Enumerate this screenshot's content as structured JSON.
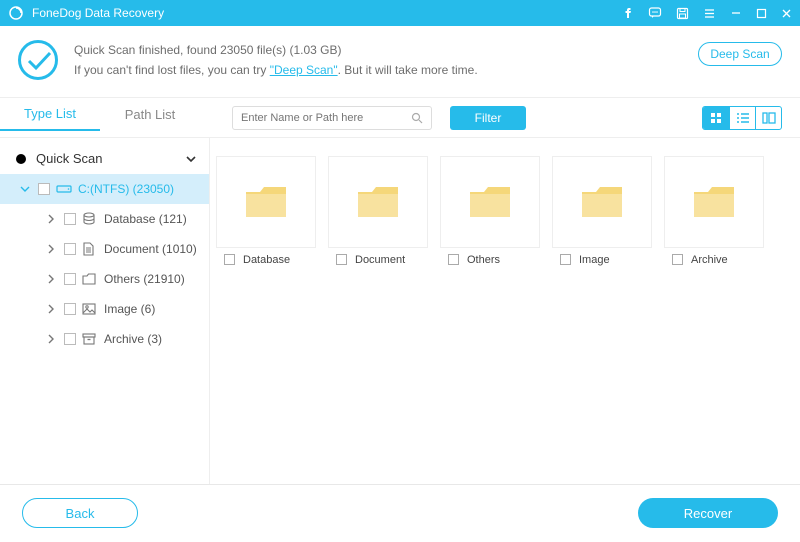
{
  "app": {
    "title": "FoneDog Data Recovery"
  },
  "banner": {
    "line1": "Quick Scan finished, found 23050 file(s) (1.03 GB)",
    "line2_prefix": "If you can't find lost files, you can try ",
    "deep_scan_link": "\"Deep Scan\"",
    "line2_suffix": ". But it will take more time.",
    "deep_scan_btn": "Deep Scan"
  },
  "tabs": {
    "type_list": "Type List",
    "path_list": "Path List"
  },
  "search": {
    "placeholder": "Enter Name or Path here"
  },
  "filter_btn": "Filter",
  "tree": {
    "root": "Quick Scan",
    "drive": "C:(NTFS) (23050)",
    "children": [
      {
        "label": "Database (121)",
        "icon": "database"
      },
      {
        "label": "Document (1010)",
        "icon": "document"
      },
      {
        "label": "Others (21910)",
        "icon": "folder"
      },
      {
        "label": "Image (6)",
        "icon": "image"
      },
      {
        "label": "Archive (3)",
        "icon": "archive"
      }
    ]
  },
  "folders": [
    {
      "label": "Database"
    },
    {
      "label": "Document"
    },
    {
      "label": "Others"
    },
    {
      "label": "Image"
    },
    {
      "label": "Archive"
    }
  ],
  "footer": {
    "back": "Back",
    "recover": "Recover"
  }
}
